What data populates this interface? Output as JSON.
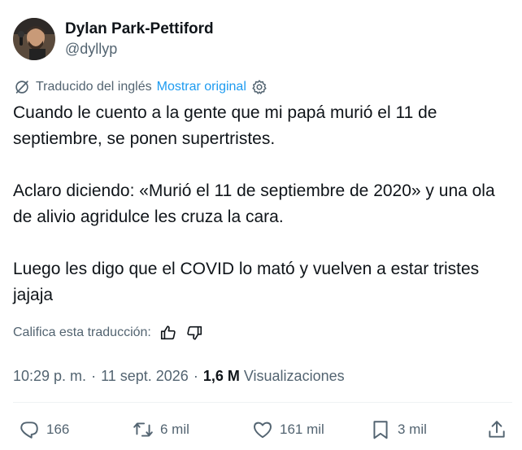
{
  "author": {
    "display_name": "Dylan Park-Pettiford",
    "handle": "@dyllyp"
  },
  "translation": {
    "label": "Traducido del inglés",
    "show_original": "Mostrar original",
    "translate_icon": "translate-icon",
    "settings_icon": "gear-icon"
  },
  "tweet": {
    "paragraphs": [
      "Cuando le cuento a la gente que mi papá murió el 11 de septiembre, se ponen supertristes.",
      "Aclaro diciendo: «Murió el 11 de septiembre de 2020» y una ola de alivio agridulce les cruza la cara.",
      "Luego les digo que el COVID lo mató y vuelven a estar tristes jajaja"
    ]
  },
  "rate": {
    "label": "Califica esta traducción:",
    "thumbs_up_icon": "thumbs-up-icon",
    "thumbs_down_icon": "thumbs-down-icon"
  },
  "meta": {
    "time": "10:29 p. m.",
    "separator": "·",
    "date": "11 sept. 2026",
    "views_count": "1,6 M",
    "views_label": "Visualizaciones"
  },
  "actions": {
    "reply": {
      "icon": "reply-icon",
      "count": "166"
    },
    "retweet": {
      "icon": "retweet-icon",
      "count": "6 mil"
    },
    "like": {
      "icon": "heart-icon",
      "count": "161 mil"
    },
    "bookmark": {
      "icon": "bookmark-icon",
      "count": "3 mil"
    },
    "share": {
      "icon": "share-icon"
    }
  },
  "colors": {
    "text": "#0f1419",
    "secondary": "#536471",
    "link": "#1d9bf0",
    "divider": "#eff3f4"
  }
}
